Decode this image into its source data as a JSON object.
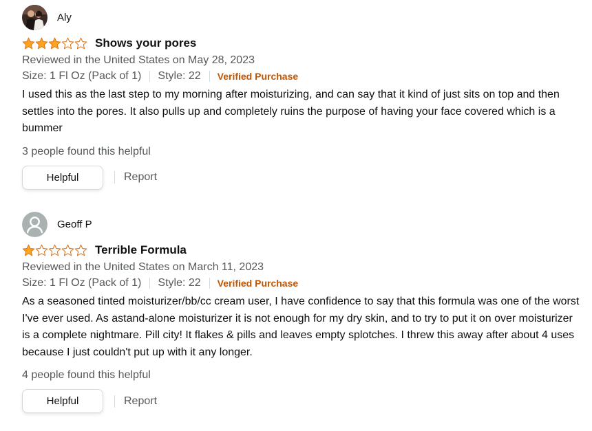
{
  "reviews": [
    {
      "profile_name": "Aly",
      "avatar": "photo-avatar",
      "rating": 3,
      "max_rating": 5,
      "title": "Shows your pores",
      "date_line": "Reviewed in the United States on May 28, 2023",
      "size": "Size: 1 Fl Oz (Pack of 1)",
      "style": "Style: 22",
      "verified": "Verified Purchase",
      "body": "I used this as the last step to my morning after moisturizing, and can say that it kind of just sits on top and then settles into the pores. It also pulls up and completely ruins the purpose of having your face covered which is a bummer",
      "helpful_count": "3 people found this helpful",
      "helpful_button": "Helpful",
      "report_link": "Report"
    },
    {
      "profile_name": "Geoff P",
      "avatar": "default-user-icon",
      "rating": 1,
      "max_rating": 5,
      "title": "Terrible Formula",
      "date_line": "Reviewed in the United States on March 11, 2023",
      "size": "Size: 1 Fl Oz (Pack of 1)",
      "style": "Style: 22",
      "verified": "Verified Purchase",
      "body": "As a seasoned tinted moisturizer/bb/cc cream user, I have confidence to say that this formula was one of the worst I've ever used. As astand-alone moisturizer it is not enough for my dry skin, and to try to put it on over moisturizer is a complete nightmare. Pill city! It flakes & pills and leaves empty splotches. I threw this away after about 4 uses because I just couldn't put up with it any longer.",
      "helpful_count": "4 people found this helpful",
      "helpful_button": "Helpful",
      "report_link": "Report"
    }
  ],
  "colors": {
    "star_fill": "#ffa41c",
    "star_stroke": "#de7921",
    "verified": "#c45500",
    "secondary_text": "#565959"
  }
}
